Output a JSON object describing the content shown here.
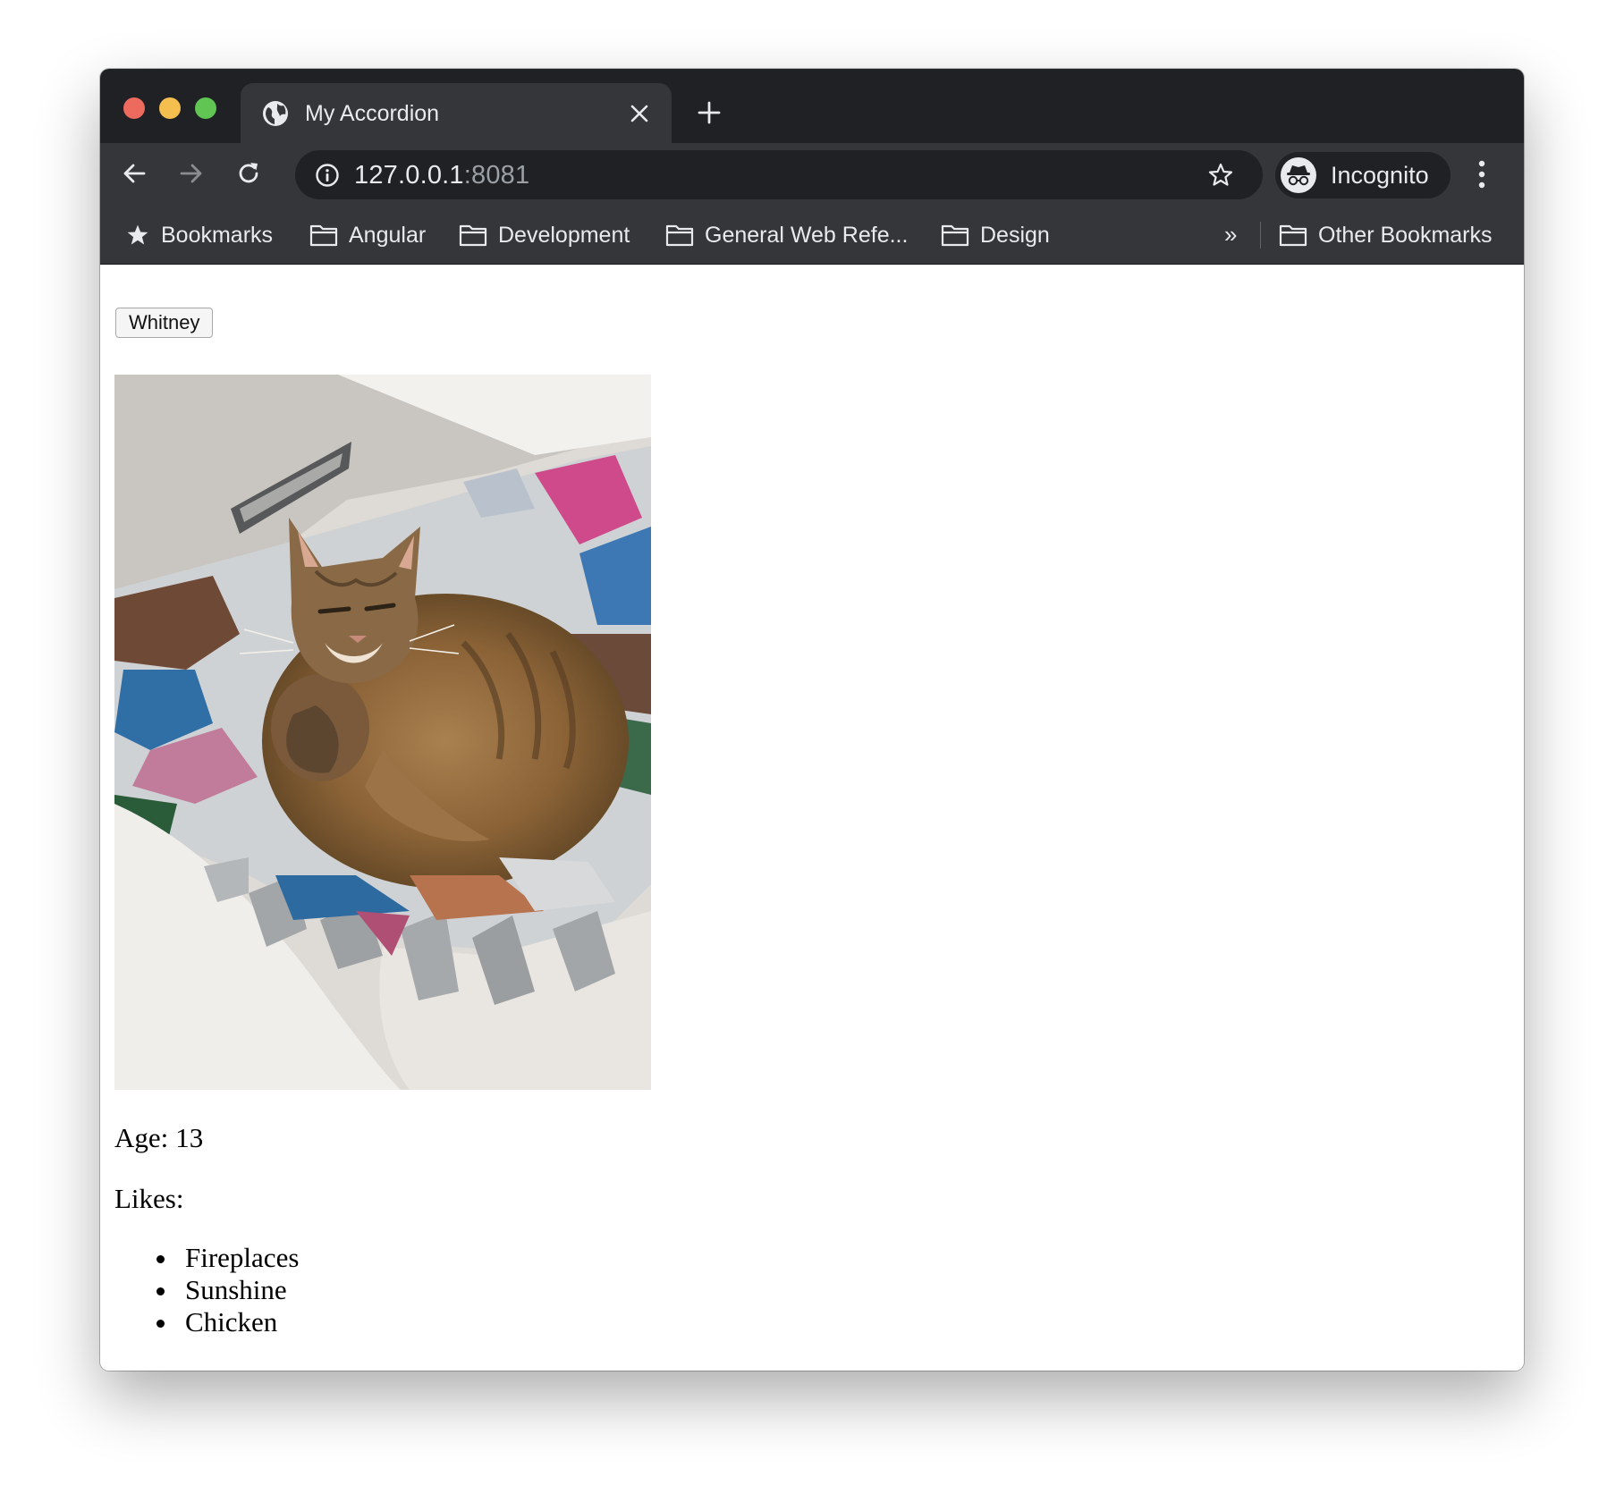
{
  "browser": {
    "tab": {
      "title": "My Accordion",
      "icon": "globe-icon"
    },
    "address": {
      "host": "127.0.0.1",
      "port": ":8081"
    },
    "profile": {
      "label": "Incognito",
      "icon": "incognito-icon"
    },
    "bookmarks": {
      "items": [
        {
          "label": "Bookmarks",
          "icon": "star-icon"
        },
        {
          "label": "Angular",
          "icon": "folder-icon"
        },
        {
          "label": "Development",
          "icon": "folder-icon"
        },
        {
          "label": "General Web Refe...",
          "icon": "folder-icon"
        },
        {
          "label": "Design",
          "icon": "folder-icon"
        }
      ],
      "overflow": "»",
      "other": {
        "label": "Other Bookmarks",
        "icon": "folder-icon"
      }
    }
  },
  "page": {
    "accordion_button": "Whitney",
    "photo": {
      "description_icon": "cat-photo"
    },
    "age_label": "Age:",
    "age_value": "13",
    "likes_label": "Likes:",
    "likes": [
      "Fireplaces",
      "Sunshine",
      "Chicken"
    ]
  },
  "colors": {
    "tabstrip": "#202124",
    "toolbar": "#35363a",
    "close": "#ed6a5e",
    "minimize": "#f5bf4f",
    "maximize": "#61c554"
  }
}
